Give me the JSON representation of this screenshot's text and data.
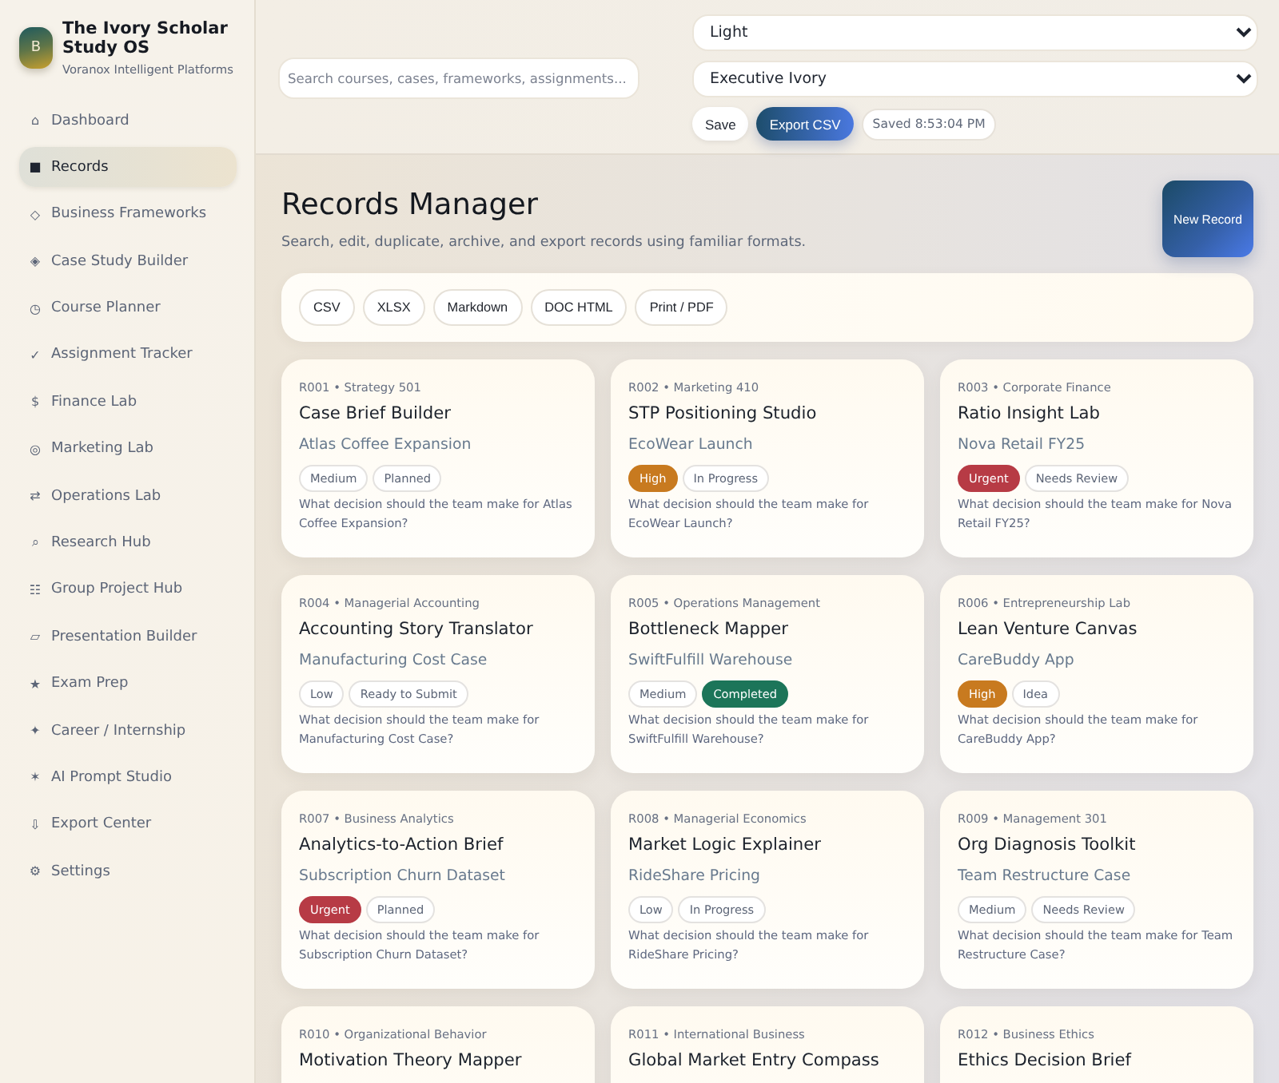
{
  "sidebar": {
    "brand": {
      "logo_letter": "B",
      "title": "The Ivory Scholar Study OS",
      "subtitle": "Voranox Intelligent Platforms"
    },
    "items": [
      {
        "icon": "⌂",
        "label": "Dashboard",
        "selected": false
      },
      {
        "icon": "■",
        "label": "Records",
        "selected": true
      },
      {
        "icon": "◇",
        "label": "Business Frameworks",
        "selected": false
      },
      {
        "icon": "◈",
        "label": "Case Study Builder",
        "selected": false
      },
      {
        "icon": "◷",
        "label": "Course Planner",
        "selected": false
      },
      {
        "icon": "✓",
        "label": "Assignment Tracker",
        "selected": false
      },
      {
        "icon": "$",
        "label": "Finance Lab",
        "selected": false
      },
      {
        "icon": "◎",
        "label": "Marketing Lab",
        "selected": false
      },
      {
        "icon": "⇄",
        "label": "Operations Lab",
        "selected": false
      },
      {
        "icon": "⌕",
        "label": "Research Hub",
        "selected": false
      },
      {
        "icon": "☷",
        "label": "Group Project Hub",
        "selected": false
      },
      {
        "icon": "▱",
        "label": "Presentation Builder",
        "selected": false
      },
      {
        "icon": "★",
        "label": "Exam Prep",
        "selected": false
      },
      {
        "icon": "✦",
        "label": "Career / Internship",
        "selected": false
      },
      {
        "icon": "✶",
        "label": "AI Prompt Studio",
        "selected": false
      },
      {
        "icon": "⇩",
        "label": "Export Center",
        "selected": false
      },
      {
        "icon": "⚙",
        "label": "Settings",
        "selected": false
      }
    ]
  },
  "toolbar": {
    "search": {
      "placeholder": "Search courses, cases, frameworks, assignments..."
    },
    "mode": "Light",
    "theme": "Executive Ivory",
    "buttons": [
      {
        "label": "Save",
        "kind": "plain"
      },
      {
        "label": "Export CSV",
        "kind": "primary"
      }
    ],
    "save_status": "Saved 8:53:04 PM"
  },
  "header": {
    "title": "Records Manager",
    "subtitle": "Search, edit, duplicate, archive, and export records using familiar formats.",
    "action": "New Record"
  },
  "export_formats": [
    "CSV",
    "XLSX",
    "Markdown",
    "DOC HTML",
    "Print / PDF"
  ],
  "cards": [
    {
      "meta": "R001 • Strategy 501",
      "title": "Case Brief Builder",
      "subject": "Atlas Coffee Expansion",
      "tags": [
        {
          "label": "Medium"
        },
        {
          "label": "Planned"
        }
      ],
      "question": "What decision should the team make for Atlas Coffee Expansion?"
    },
    {
      "meta": "R002 • Marketing 410",
      "title": "STP Positioning Studio",
      "subject": "EcoWear Launch",
      "tags": [
        {
          "label": "High",
          "color": "#c87a1f"
        },
        {
          "label": "In Progress"
        }
      ],
      "question": "What decision should the team make for EcoWear Launch?"
    },
    {
      "meta": "R003 • Corporate Finance",
      "title": "Ratio Insight Lab",
      "subject": "Nova Retail FY25",
      "tags": [
        {
          "label": "Urgent",
          "color": "#b73b45"
        },
        {
          "label": "Needs Review"
        }
      ],
      "question": "What decision should the team make for Nova Retail FY25?"
    },
    {
      "meta": "R004 • Managerial Accounting",
      "title": "Accounting Story Translator",
      "subject": "Manufacturing Cost Case",
      "tags": [
        {
          "label": "Low"
        },
        {
          "label": "Ready to Submit"
        }
      ],
      "question": "What decision should the team make for Manufacturing Cost Case?"
    },
    {
      "meta": "R005 • Operations Management",
      "title": "Bottleneck Mapper",
      "subject": "SwiftFulfill Warehouse",
      "tags": [
        {
          "label": "Medium"
        },
        {
          "label": "Completed",
          "color": "#1c7559"
        }
      ],
      "question": "What decision should the team make for SwiftFulfill Warehouse?"
    },
    {
      "meta": "R006 • Entrepreneurship Lab",
      "title": "Lean Venture Canvas",
      "subject": "CareBuddy App",
      "tags": [
        {
          "label": "High",
          "color": "#c87a1f"
        },
        {
          "label": "Idea"
        }
      ],
      "question": "What decision should the team make for CareBuddy App?"
    },
    {
      "meta": "R007 • Business Analytics",
      "title": "Analytics-to-Action Brief",
      "subject": "Subscription Churn Dataset",
      "tags": [
        {
          "label": "Urgent",
          "color": "#b73b45"
        },
        {
          "label": "Planned"
        }
      ],
      "question": "What decision should the team make for Subscription Churn Dataset?"
    },
    {
      "meta": "R008 • Managerial Economics",
      "title": "Market Logic Explainer",
      "subject": "RideShare Pricing",
      "tags": [
        {
          "label": "Low"
        },
        {
          "label": "In Progress"
        }
      ],
      "question": "What decision should the team make for RideShare Pricing?"
    },
    {
      "meta": "R009 • Management 301",
      "title": "Org Diagnosis Toolkit",
      "subject": "Team Restructure Case",
      "tags": [
        {
          "label": "Medium"
        },
        {
          "label": "Needs Review"
        }
      ],
      "question": "What decision should the team make for Team Restructure Case?"
    },
    {
      "meta": "R010 • Organizational Behavior",
      "title": "Motivation Theory Mapper"
    },
    {
      "meta": "R011 • International Business",
      "title": "Global Market Entry Compass"
    },
    {
      "meta": "R012 • Business Ethics",
      "title": "Ethics Decision Brief"
    }
  ]
}
